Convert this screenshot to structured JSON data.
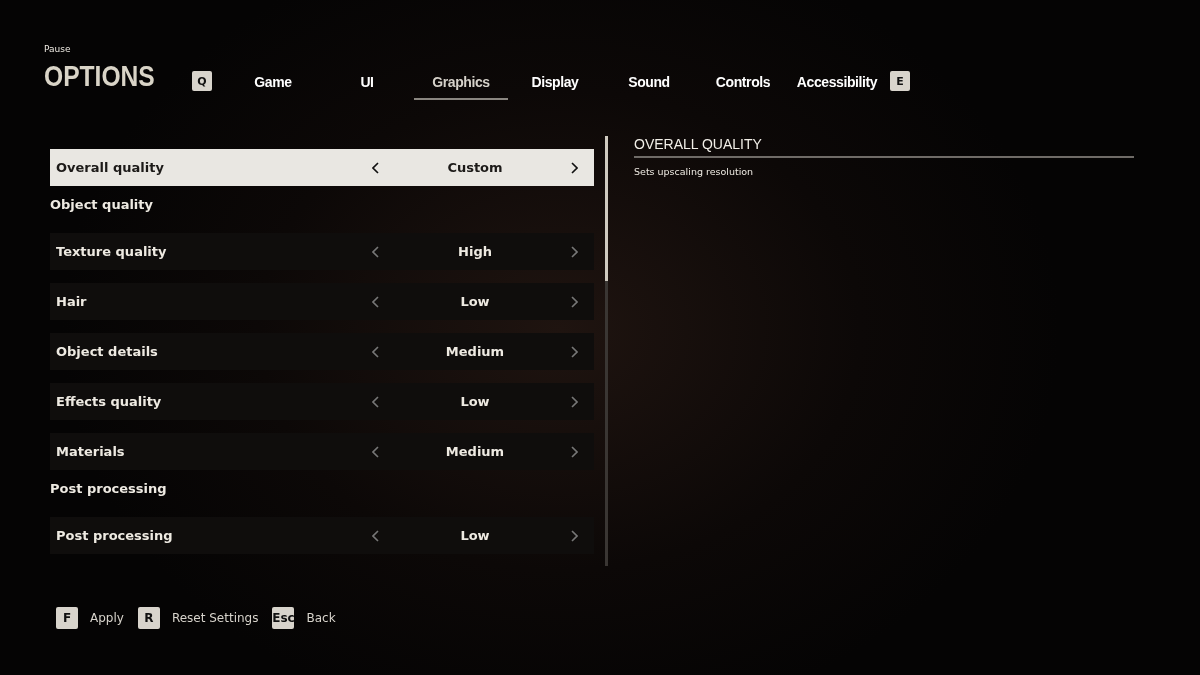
{
  "header": {
    "breadcrumb": "Pause",
    "title": "OPTIONS"
  },
  "tabs": {
    "prev_key": "Q",
    "next_key": "E",
    "items": [
      {
        "label": "Game",
        "selected": false
      },
      {
        "label": "UI",
        "selected": false
      },
      {
        "label": "Graphics",
        "selected": true
      },
      {
        "label": "Display",
        "selected": false
      },
      {
        "label": "Sound",
        "selected": false
      },
      {
        "label": "Controls",
        "selected": false
      },
      {
        "label": "Accessibility",
        "selected": false
      }
    ]
  },
  "settings": [
    {
      "kind": "option",
      "label": "Overall quality",
      "value": "Custom",
      "selected": true
    },
    {
      "kind": "section",
      "label": "Object quality"
    },
    {
      "kind": "option",
      "label": "Texture quality",
      "value": "High",
      "selected": false
    },
    {
      "kind": "option",
      "label": "Hair",
      "value": "Low",
      "selected": false
    },
    {
      "kind": "option",
      "label": "Object details",
      "value": "Medium",
      "selected": false
    },
    {
      "kind": "option",
      "label": "Effects quality",
      "value": "Low",
      "selected": false
    },
    {
      "kind": "option",
      "label": "Materials",
      "value": "Medium",
      "selected": false
    },
    {
      "kind": "section",
      "label": "Post processing"
    },
    {
      "kind": "option",
      "label": "Post processing",
      "value": "Low",
      "selected": false
    }
  ],
  "details": {
    "title": "OVERALL QUALITY",
    "description": "Sets upscaling resolution"
  },
  "footer": [
    {
      "key": "F",
      "label": "Apply"
    },
    {
      "key": "R",
      "label": "Reset Settings"
    },
    {
      "key": "Esc",
      "label": "Back"
    }
  ]
}
